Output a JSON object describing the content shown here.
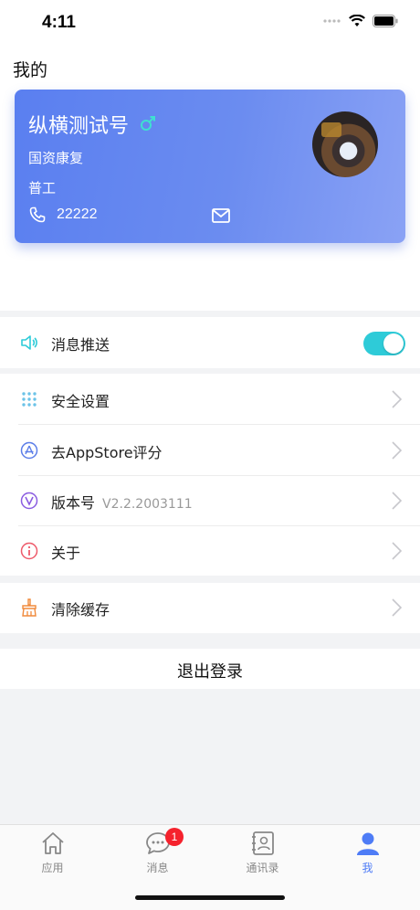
{
  "status_bar": {
    "time": "4:11"
  },
  "page_title": "我的",
  "profile": {
    "name": "纵横测试号",
    "gender_symbol": "♂",
    "organization": "国资康复",
    "role": "普工",
    "phone": "22222"
  },
  "settings": {
    "push": {
      "label": "消息推送",
      "enabled": true
    },
    "security": {
      "label": "安全设置"
    },
    "rate": {
      "label": "去AppStore评分"
    },
    "version": {
      "label": "版本号",
      "value": "V2.2.2003111"
    },
    "about": {
      "label": "关于"
    },
    "clear_cache": {
      "label": "清除缓存"
    }
  },
  "logout_label": "退出登录",
  "tab_bar": {
    "items": [
      {
        "label": "应用",
        "icon": "home-icon",
        "active": false
      },
      {
        "label": "消息",
        "icon": "message-icon",
        "active": false,
        "badge": "1"
      },
      {
        "label": "通讯录",
        "icon": "contacts-icon",
        "active": false
      },
      {
        "label": "我",
        "icon": "person-icon",
        "active": true
      }
    ]
  },
  "colors": {
    "accent": "#4e7cf6",
    "toggle_on": "#2ecbd8",
    "card_gradient_start": "#5a7ff0",
    "card_gradient_end": "#8aa2f5",
    "badge": "#f5222d"
  }
}
